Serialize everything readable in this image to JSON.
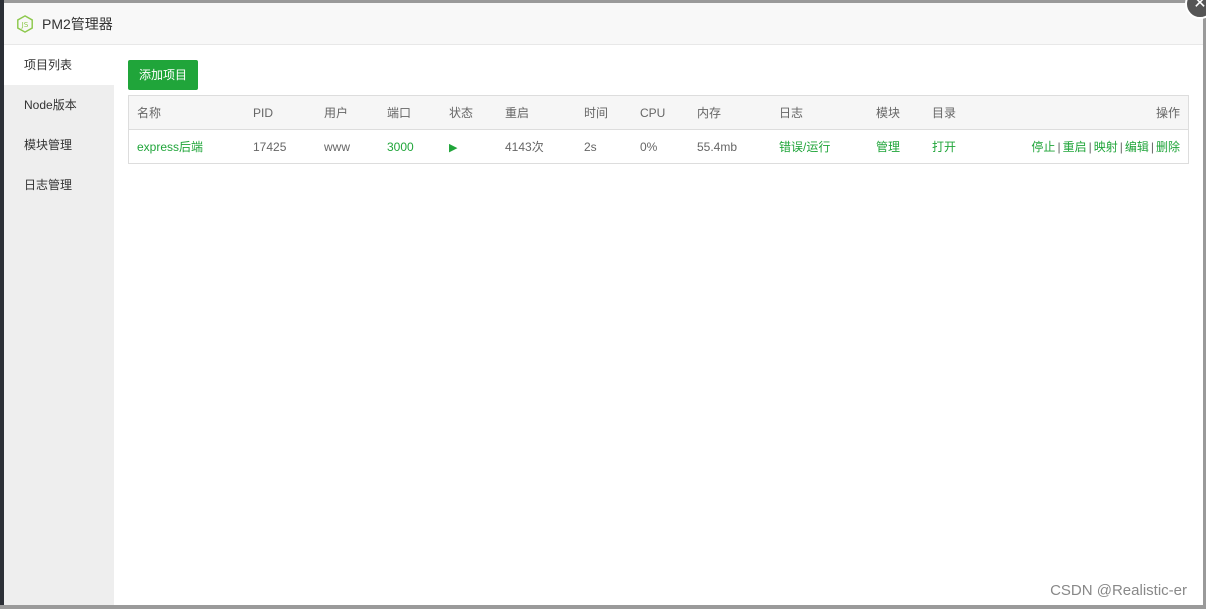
{
  "window": {
    "title": "PM2管理器",
    "logo_icon": "nodejs-icon",
    "close_icon": "close-icon"
  },
  "sidebar": {
    "items": [
      {
        "label": "项目列表",
        "active": true
      },
      {
        "label": "Node版本",
        "active": false
      },
      {
        "label": "模块管理",
        "active": false
      },
      {
        "label": "日志管理",
        "active": false
      }
    ]
  },
  "toolbar": {
    "add_label": "添加项目"
  },
  "table": {
    "headers": [
      "名称",
      "PID",
      "用户",
      "端口",
      "状态",
      "重启",
      "时间",
      "CPU",
      "内存",
      "日志",
      "模块",
      "目录",
      "操作"
    ],
    "rows": [
      {
        "name": "express后端",
        "pid": "17425",
        "user": "www",
        "port": "3000",
        "status_icon": "play-icon",
        "restarts": "4143次",
        "time": "2s",
        "cpu": "0%",
        "memory": "55.4mb",
        "log": "错误/运行",
        "module": "管理",
        "dir": "打开",
        "actions": [
          "停止",
          "重启",
          "映射",
          "编辑",
          "删除"
        ]
      }
    ]
  },
  "colors": {
    "accent": "#20a53a"
  },
  "watermark": "CSDN @Realistic-er"
}
